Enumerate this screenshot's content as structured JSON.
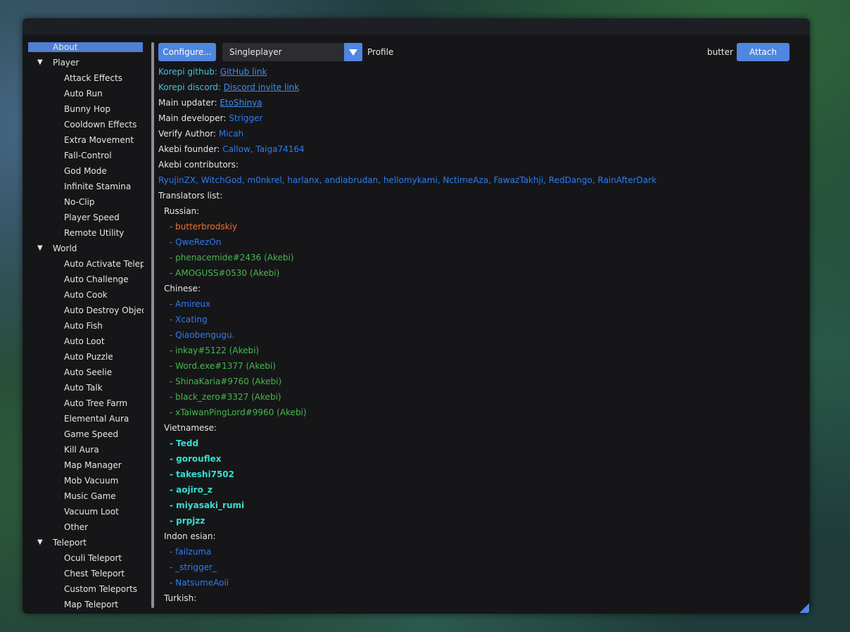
{
  "sidebar": {
    "items": [
      {
        "label": "About",
        "level": 0,
        "selected": true
      },
      {
        "label": "Player",
        "level": 0,
        "expanded": true
      },
      {
        "label": "Attack Effects",
        "level": 1
      },
      {
        "label": "Auto Run",
        "level": 1
      },
      {
        "label": "Bunny Hop",
        "level": 1
      },
      {
        "label": "Cooldown Effects",
        "level": 1
      },
      {
        "label": "Extra Movement",
        "level": 1
      },
      {
        "label": "Fall-Control",
        "level": 1
      },
      {
        "label": "God Mode",
        "level": 1
      },
      {
        "label": "Infinite Stamina",
        "level": 1
      },
      {
        "label": "No-Clip",
        "level": 1
      },
      {
        "label": "Player Speed",
        "level": 1
      },
      {
        "label": "Remote Utility",
        "level": 1
      },
      {
        "label": "World",
        "level": 0,
        "expanded": true
      },
      {
        "label": "Auto Activate Telepor",
        "level": 1
      },
      {
        "label": "Auto Challenge",
        "level": 1
      },
      {
        "label": "Auto Cook",
        "level": 1
      },
      {
        "label": "Auto Destroy Objects",
        "level": 1
      },
      {
        "label": "Auto Fish",
        "level": 1
      },
      {
        "label": "Auto Loot",
        "level": 1
      },
      {
        "label": "Auto Puzzle",
        "level": 1
      },
      {
        "label": "Auto Seelie",
        "level": 1
      },
      {
        "label": "Auto Talk",
        "level": 1
      },
      {
        "label": "Auto Tree Farm",
        "level": 1
      },
      {
        "label": "Elemental Aura",
        "level": 1
      },
      {
        "label": "Game Speed",
        "level": 1
      },
      {
        "label": "Kill Aura",
        "level": 1
      },
      {
        "label": "Map Manager",
        "level": 1
      },
      {
        "label": "Mob Vacuum",
        "level": 1
      },
      {
        "label": "Music Game",
        "level": 1
      },
      {
        "label": "Vacuum Loot",
        "level": 1
      },
      {
        "label": "Other",
        "level": 1
      },
      {
        "label": "Teleport",
        "level": 0,
        "expanded": true
      },
      {
        "label": "Oculi Teleport",
        "level": 1
      },
      {
        "label": "Chest Teleport",
        "level": 1
      },
      {
        "label": "Custom Teleports",
        "level": 1
      },
      {
        "label": "Map Teleport",
        "level": 1
      }
    ],
    "expand_glyph": "▼"
  },
  "toolbar": {
    "configure_label": "Configure...",
    "profile_value": "Singleplayer",
    "profile_label": "Profile",
    "user_label": "butter",
    "attach_label": "Attach"
  },
  "about": {
    "rows": [
      {
        "parts": [
          {
            "t": "Korepi github: ",
            "c": "cyan"
          },
          {
            "t": "GitHub link",
            "c": "link"
          }
        ]
      },
      {
        "parts": [
          {
            "t": "Korepi discord: ",
            "c": "cyan"
          },
          {
            "t": "Discord invite link",
            "c": "link"
          }
        ]
      },
      {
        "parts": [
          {
            "t": "Main updater: ",
            "c": "white"
          },
          {
            "t": "EtoShinya",
            "c": "link"
          }
        ]
      },
      {
        "parts": [
          {
            "t": "Main developer: ",
            "c": "white"
          },
          {
            "t": " Strigger",
            "c": "blue"
          }
        ]
      },
      {
        "parts": [
          {
            "t": "Verify Author: ",
            "c": "white"
          },
          {
            "t": " Micah",
            "c": "blue"
          }
        ]
      },
      {
        "parts": [
          {
            "t": "Akebi founder: ",
            "c": "white"
          },
          {
            "t": " Callow, Taiga74164",
            "c": "blue"
          }
        ]
      },
      {
        "parts": [
          {
            "t": "Akebi contributors:",
            "c": "white"
          }
        ]
      },
      {
        "parts": [
          {
            "t": "RyujinZX, WitchGod, m0nkrel, harlanx, andiabrudan, hellomykami, NctimeAza, FawazTakhji, RedDango, RainAfterDark",
            "c": "blue"
          }
        ]
      },
      {
        "parts": [
          {
            "t": "Translators list:",
            "c": "white"
          }
        ]
      },
      {
        "indent": 1,
        "parts": [
          {
            "t": "Russian:",
            "c": "white"
          }
        ]
      },
      {
        "indent": 2,
        "parts": [
          {
            "t": "- butterbrodskiy",
            "c": "orange"
          }
        ]
      },
      {
        "indent": 2,
        "parts": [
          {
            "t": "- QweRezOn",
            "c": "blue"
          }
        ]
      },
      {
        "indent": 2,
        "parts": [
          {
            "t": "- phenacemide#2436 (Akebi)",
            "c": "green"
          }
        ]
      },
      {
        "indent": 2,
        "parts": [
          {
            "t": "- AMOGUSS#0530 (Akebi)",
            "c": "green"
          }
        ]
      },
      {
        "indent": 1,
        "parts": [
          {
            "t": "Chinese:",
            "c": "white"
          }
        ]
      },
      {
        "indent": 2,
        "parts": [
          {
            "t": "- Amireux",
            "c": "blue"
          }
        ]
      },
      {
        "indent": 2,
        "parts": [
          {
            "t": "- Xcating",
            "c": "blue"
          }
        ]
      },
      {
        "indent": 2,
        "parts": [
          {
            "t": "- Qiaobengugu.",
            "c": "blue"
          }
        ]
      },
      {
        "indent": 2,
        "parts": [
          {
            "t": "- inkay#5122 (Akebi)",
            "c": "green"
          }
        ]
      },
      {
        "indent": 2,
        "parts": [
          {
            "t": "- Word.exe#1377 (Akebi)",
            "c": "green"
          }
        ]
      },
      {
        "indent": 2,
        "parts": [
          {
            "t": "- ShinaKaria#9760 (Akebi)",
            "c": "green"
          }
        ]
      },
      {
        "indent": 2,
        "parts": [
          {
            "t": "- black_zero#3327 (Akebi)",
            "c": "green"
          }
        ]
      },
      {
        "indent": 2,
        "parts": [
          {
            "t": "- xTaiwanPingLord#9960 (Akebi)",
            "c": "green"
          }
        ]
      },
      {
        "indent": 1,
        "parts": [
          {
            "t": "Vietnamese:",
            "c": "white"
          }
        ]
      },
      {
        "indent": 2,
        "parts": [
          {
            "t": "- Tedd",
            "c": "teal"
          }
        ]
      },
      {
        "indent": 2,
        "parts": [
          {
            "t": "- gorouflex",
            "c": "teal"
          }
        ]
      },
      {
        "indent": 2,
        "parts": [
          {
            "t": "- takeshi7502",
            "c": "teal"
          }
        ]
      },
      {
        "indent": 2,
        "parts": [
          {
            "t": "- aojiro_z",
            "c": "teal"
          }
        ]
      },
      {
        "indent": 2,
        "parts": [
          {
            "t": "- miyasaki_rumi",
            "c": "teal"
          }
        ]
      },
      {
        "indent": 2,
        "parts": [
          {
            "t": "- prpjzz",
            "c": "teal"
          }
        ]
      },
      {
        "indent": 1,
        "parts": [
          {
            "t": "Indon esian:",
            "c": "white"
          }
        ]
      },
      {
        "indent": 2,
        "parts": [
          {
            "t": "- failzuma",
            "c": "blue"
          }
        ]
      },
      {
        "indent": 2,
        "parts": [
          {
            "t": "- _strigger_",
            "c": "blue"
          }
        ]
      },
      {
        "indent": 2,
        "parts": [
          {
            "t": "- NatsumeAoii",
            "c": "blue"
          }
        ]
      },
      {
        "indent": 1,
        "parts": [
          {
            "t": "Turkish:",
            "c": "white"
          }
        ]
      }
    ]
  },
  "colors": {
    "accent": "#4f86e0",
    "selected": "#4f7fd2",
    "window_bg": "#161618"
  }
}
